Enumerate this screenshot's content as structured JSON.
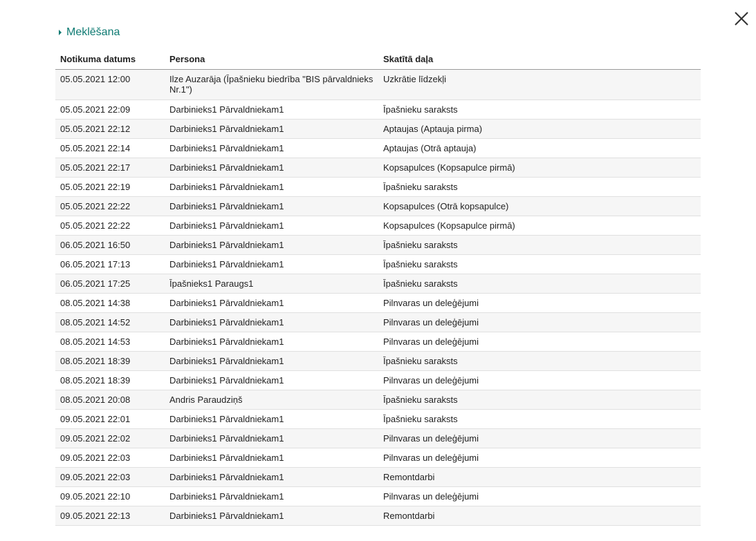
{
  "close_icon": "close-icon",
  "search": {
    "label": "Meklēšana",
    "icon": "caret-right-icon"
  },
  "table": {
    "headers": {
      "date": "Notikuma datums",
      "person": "Persona",
      "section": "Skatītā daļa"
    },
    "rows": [
      {
        "date": "05.05.2021 12:00",
        "person": "Ilze Auzarāja (Īpašnieku biedrība \"BIS pārvaldnieks Nr.1\")",
        "section": "Uzkrātie līdzekļi"
      },
      {
        "date": "05.05.2021 22:09",
        "person": "Darbinieks1 Pārvaldniekam1",
        "section": "Īpašnieku saraksts"
      },
      {
        "date": "05.05.2021 22:12",
        "person": "Darbinieks1 Pārvaldniekam1",
        "section": "Aptaujas (Aptauja pirma)"
      },
      {
        "date": "05.05.2021 22:14",
        "person": "Darbinieks1 Pārvaldniekam1",
        "section": "Aptaujas (Otrā aptauja)"
      },
      {
        "date": "05.05.2021 22:17",
        "person": "Darbinieks1 Pārvaldniekam1",
        "section": "Kopsapulces (Kopsapulce pirmā)"
      },
      {
        "date": "05.05.2021 22:19",
        "person": "Darbinieks1 Pārvaldniekam1",
        "section": "Īpašnieku saraksts"
      },
      {
        "date": "05.05.2021 22:22",
        "person": "Darbinieks1 Pārvaldniekam1",
        "section": "Kopsapulces (Otrā kopsapulce)"
      },
      {
        "date": "05.05.2021 22:22",
        "person": "Darbinieks1 Pārvaldniekam1",
        "section": "Kopsapulces (Kopsapulce pirmā)"
      },
      {
        "date": "06.05.2021 16:50",
        "person": "Darbinieks1 Pārvaldniekam1",
        "section": "Īpašnieku saraksts"
      },
      {
        "date": "06.05.2021 17:13",
        "person": "Darbinieks1 Pārvaldniekam1",
        "section": "Īpašnieku saraksts"
      },
      {
        "date": "06.05.2021 17:25",
        "person": "Īpašnieks1 Paraugs1",
        "section": "Īpašnieku saraksts"
      },
      {
        "date": "08.05.2021 14:38",
        "person": "Darbinieks1 Pārvaldniekam1",
        "section": "Pilnvaras un deleģējumi"
      },
      {
        "date": "08.05.2021 14:52",
        "person": "Darbinieks1 Pārvaldniekam1",
        "section": "Pilnvaras un deleģējumi"
      },
      {
        "date": "08.05.2021 14:53",
        "person": "Darbinieks1 Pārvaldniekam1",
        "section": "Pilnvaras un deleģējumi"
      },
      {
        "date": "08.05.2021 18:39",
        "person": "Darbinieks1 Pārvaldniekam1",
        "section": "Īpašnieku saraksts"
      },
      {
        "date": "08.05.2021 18:39",
        "person": "Darbinieks1 Pārvaldniekam1",
        "section": "Pilnvaras un deleģējumi"
      },
      {
        "date": "08.05.2021 20:08",
        "person": "Andris Paraudziņš",
        "section": "Īpašnieku saraksts"
      },
      {
        "date": "09.05.2021 22:01",
        "person": "Darbinieks1 Pārvaldniekam1",
        "section": "Īpašnieku saraksts"
      },
      {
        "date": "09.05.2021 22:02",
        "person": "Darbinieks1 Pārvaldniekam1",
        "section": "Pilnvaras un deleģējumi"
      },
      {
        "date": "09.05.2021 22:03",
        "person": "Darbinieks1 Pārvaldniekam1",
        "section": "Pilnvaras un deleģējumi"
      },
      {
        "date": "09.05.2021 22:03",
        "person": "Darbinieks1 Pārvaldniekam1",
        "section": "Remontdarbi"
      },
      {
        "date": "09.05.2021 22:10",
        "person": "Darbinieks1 Pārvaldniekam1",
        "section": "Pilnvaras un deleģējumi"
      },
      {
        "date": "09.05.2021 22:13",
        "person": "Darbinieks1 Pārvaldniekam1",
        "section": "Remontdarbi"
      }
    ]
  },
  "colors": {
    "accent": "#0f7b73",
    "row_alt": "#f6f6f6"
  }
}
